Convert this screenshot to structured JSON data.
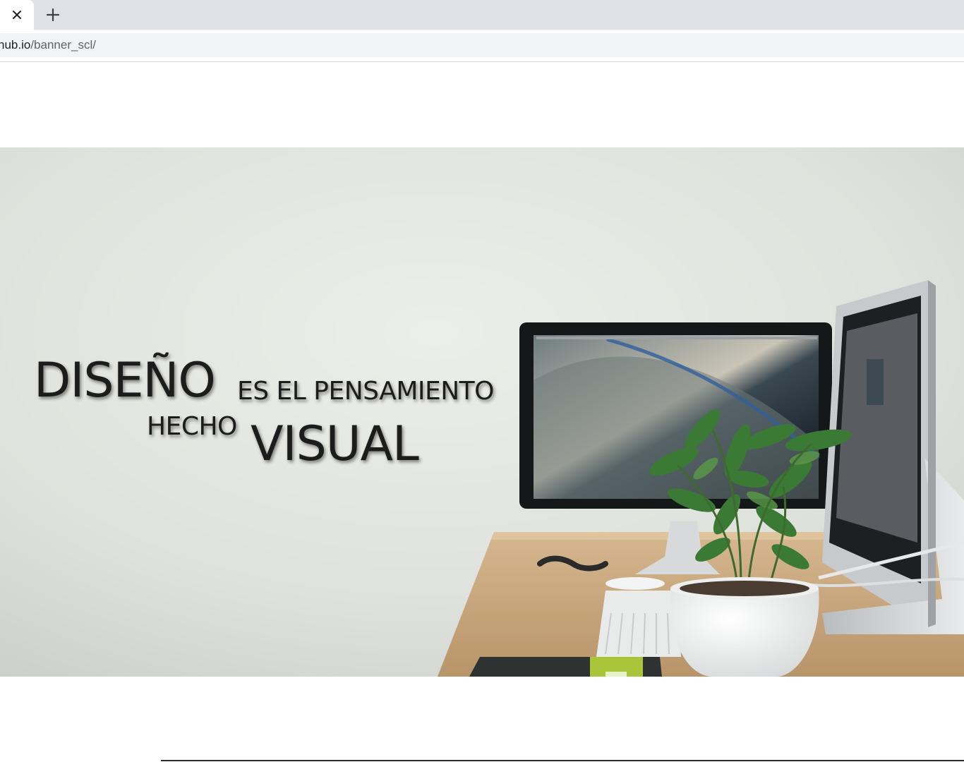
{
  "browser": {
    "url_host": "hub.io",
    "url_path": "/banner_scl/",
    "icons": {
      "tab_close": "close-icon",
      "new_tab": "plus-icon"
    }
  },
  "banner": {
    "headline": {
      "word1": "DISEÑO",
      "word2": "ES EL PENSAMIENTO",
      "word3": "HECHO",
      "word4": "VISUAL"
    },
    "text_color": "#1c1c1c"
  }
}
